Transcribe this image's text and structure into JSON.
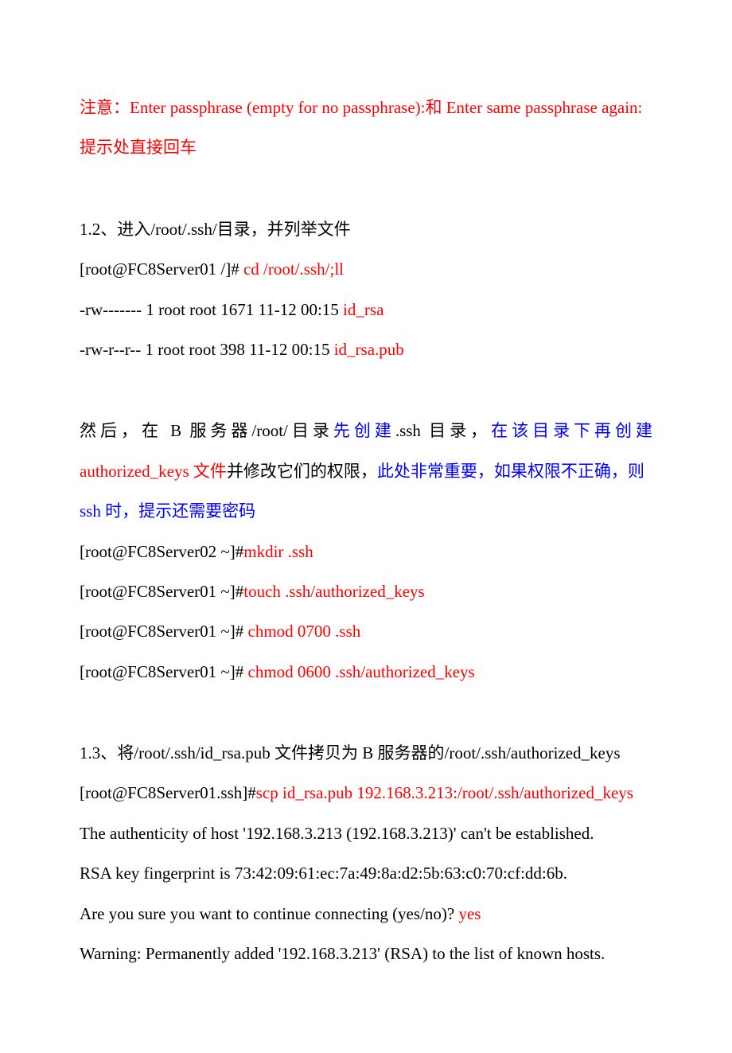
{
  "block1": {
    "p1_red": "注意：Enter passphrase (empty for no passphrase):和 Enter same passphrase again:提示处直接回车"
  },
  "block2": {
    "p1": "1.2、进入/root/.ssh/目录，并列举文件",
    "p2_a": "[root@FC8Server01 /]# ",
    "p2_b": "cd /root/.ssh/;ll",
    "p3_a": "-rw------- 1 root root 1671 11-12 00:15 ",
    "p3_b": "id_rsa",
    "p4_a": "-rw-r--r-- 1 root root 398 11-12 00:15 ",
    "p4_b": "id_rsa.pub"
  },
  "block3": {
    "p1_a": "然后，在 B 服务器/root/目录",
    "p1_b": "先创建",
    "p1_c": ".ssh 目录，",
    "p1_d": "在该目录下再创建",
    "p1_e": "authorized_keys 文件",
    "p1_f": "并修改它们的权限，",
    "p1_g": "此处非常重要，如果权限不正确，则 ssh 时，提示还需要密码",
    "p2_a": "[root@FC8Server02 ~]#",
    "p2_b": "mkdir .ssh",
    "p3_a": "[root@FC8Server01 ~]#",
    "p3_b": "touch .ssh/authorized_keys",
    "p4_a": "[root@FC8Server01 ~]# ",
    "p4_b": "chmod 0700 .ssh",
    "p5_a": "[root@FC8Server01 ~]# ",
    "p5_b": "chmod 0600 .ssh/authorized_keys"
  },
  "block4": {
    "p1": "1.3、将/root/.ssh/id_rsa.pub 文件拷贝为 B 服务器的/root/.ssh/authorized_keys",
    "p2_a": "[root@FC8Server01.ssh]#",
    "p2_b": "scp id_rsa.pub 192.168.3.213:/root/.ssh/authorized_keys",
    "p3": "The authenticity of host '192.168.3.213 (192.168.3.213)' can't be established.",
    "p4": "RSA key fingerprint is 73:42:09:61:ec:7a:49:8a:d2:5b:63:c0:70:cf:dd:6b.",
    "p5_a": "Are you sure you want to continue connecting (yes/no)? ",
    "p5_b": "yes",
    "p6": "Warning: Permanently added '192.168.3.213' (RSA) to the list of known hosts."
  }
}
